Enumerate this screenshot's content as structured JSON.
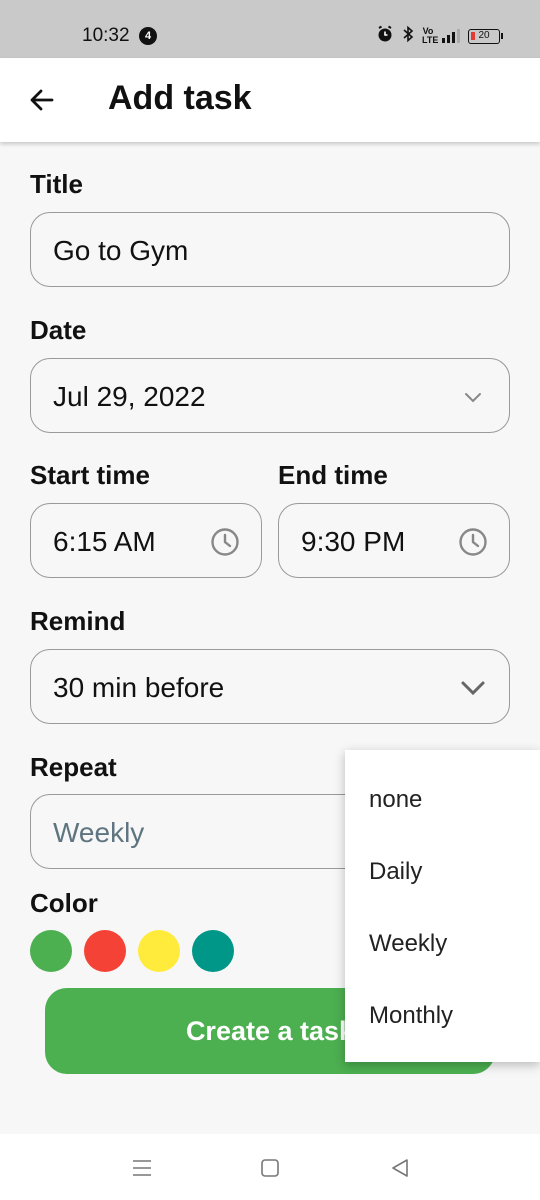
{
  "status_bar": {
    "time": "10:32",
    "notification_count": "4",
    "network_label": "Vo LTE",
    "battery": "20"
  },
  "appbar": {
    "title": "Add task",
    "back_icon": "arrow-left-icon"
  },
  "form": {
    "title_label": "Title",
    "title_value": "Go to Gym",
    "date_label": "Date",
    "date_value": "Jul 29, 2022",
    "start_time_label": "Start time",
    "start_time_value": "6:15 AM",
    "end_time_label": "End time",
    "end_time_value": "9:30 PM",
    "remind_label": "Remind",
    "remind_value": "30 min before",
    "repeat_label": "Repeat",
    "repeat_value": "Weekly",
    "color_label": "Color",
    "colors": [
      "#4caf50",
      "#f44336",
      "#ffeb3b",
      "#009688"
    ],
    "submit_label": "Create a task"
  },
  "repeat_dropdown": {
    "options": [
      "none",
      "Daily",
      "Weekly",
      "Monthly"
    ]
  },
  "icons": {
    "date": "chevron-down-icon",
    "time": "clock-icon",
    "remind": "chevron-down-icon"
  }
}
